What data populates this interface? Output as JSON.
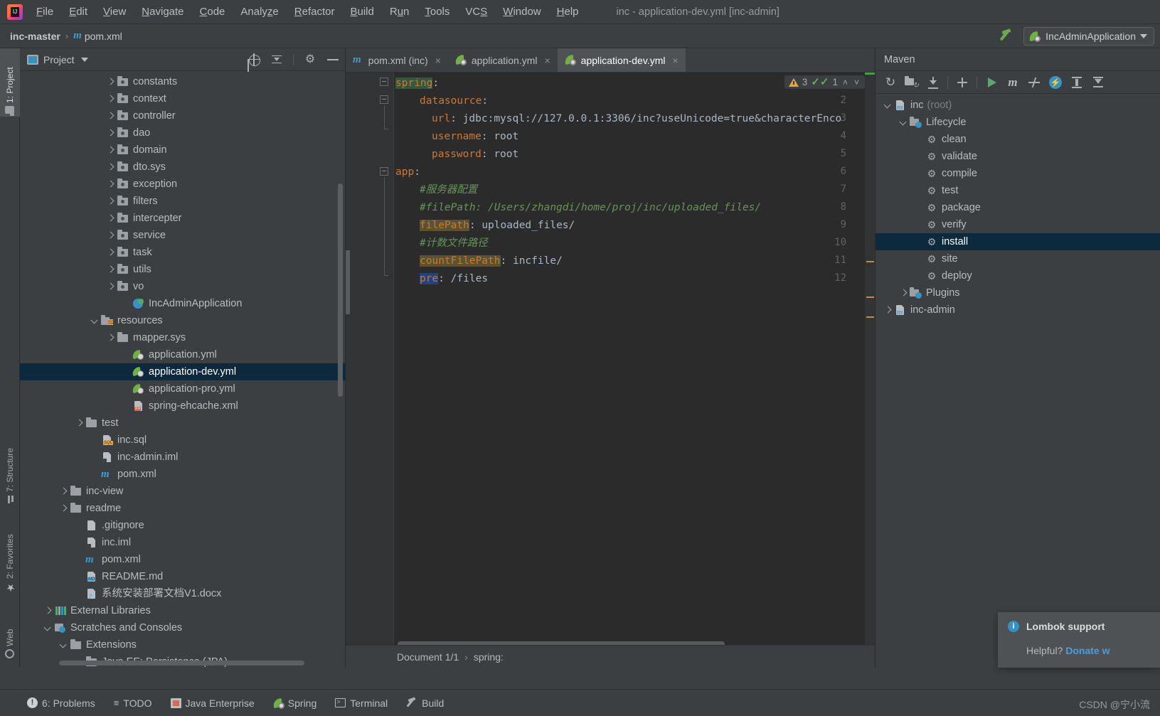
{
  "window": {
    "title": "inc - application-dev.yml [inc-admin]",
    "app_icon": "intellij-idea-logo"
  },
  "menubar": {
    "items": [
      {
        "label": "File",
        "mnemonic": "F"
      },
      {
        "label": "Edit",
        "mnemonic": "E"
      },
      {
        "label": "View",
        "mnemonic": "V"
      },
      {
        "label": "Navigate",
        "mnemonic": "N"
      },
      {
        "label": "Code",
        "mnemonic": "C"
      },
      {
        "label": "Analyze",
        "mnemonic": "z"
      },
      {
        "label": "Refactor",
        "mnemonic": "R"
      },
      {
        "label": "Build",
        "mnemonic": "B"
      },
      {
        "label": "Run",
        "mnemonic": "u"
      },
      {
        "label": "Tools",
        "mnemonic": "T"
      },
      {
        "label": "VCS",
        "mnemonic": "S"
      },
      {
        "label": "Window",
        "mnemonic": "W"
      },
      {
        "label": "Help",
        "mnemonic": "H"
      }
    ]
  },
  "navbar": {
    "crumbs": [
      "inc-master",
      "pom.xml"
    ],
    "separator": "›",
    "build_icon": "hammer-icon",
    "run_config": {
      "label": "IncAdminApplication",
      "icon": "spring-boot-icon",
      "caret": "▼"
    }
  },
  "left_strip": {
    "tabs": [
      {
        "label": "1: Project",
        "icon": "folder-icon",
        "active": true
      },
      {
        "label": "7: Structure",
        "icon": "structure-icon",
        "active": false
      },
      {
        "label": "2: Favorites",
        "icon": "star-icon",
        "active": false
      },
      {
        "label": "Web",
        "icon": "web-icon",
        "active": false
      }
    ]
  },
  "project_panel": {
    "title": "Project",
    "title_icon": "project-view-icon",
    "caret": "▼",
    "toolbar": [
      {
        "name": "locate-icon",
        "title": "Select Opened File"
      },
      {
        "name": "collapse-all-icon",
        "title": "Collapse All"
      },
      {
        "name": "gear-icon",
        "title": "Settings"
      },
      {
        "name": "minimize-icon",
        "title": "Hide"
      }
    ],
    "tree": [
      {
        "label": "constants",
        "indent": 5,
        "arrow": "right",
        "icon": "pkg",
        "selected": false
      },
      {
        "label": "context",
        "indent": 5,
        "arrow": "right",
        "icon": "pkg",
        "selected": false
      },
      {
        "label": "controller",
        "indent": 5,
        "arrow": "right",
        "icon": "pkg",
        "selected": false
      },
      {
        "label": "dao",
        "indent": 5,
        "arrow": "right",
        "icon": "pkg",
        "selected": false
      },
      {
        "label": "domain",
        "indent": 5,
        "arrow": "right",
        "icon": "pkg",
        "selected": false
      },
      {
        "label": "dto.sys",
        "indent": 5,
        "arrow": "right",
        "icon": "pkg",
        "selected": false
      },
      {
        "label": "exception",
        "indent": 5,
        "arrow": "right",
        "icon": "pkg",
        "selected": false
      },
      {
        "label": "filters",
        "indent": 5,
        "arrow": "right",
        "icon": "pkg",
        "selected": false
      },
      {
        "label": "intercepter",
        "indent": 5,
        "arrow": "right",
        "icon": "pkg",
        "selected": false
      },
      {
        "label": "service",
        "indent": 5,
        "arrow": "right",
        "icon": "pkg",
        "selected": false
      },
      {
        "label": "task",
        "indent": 5,
        "arrow": "right",
        "icon": "pkg",
        "selected": false
      },
      {
        "label": "utils",
        "indent": 5,
        "arrow": "right",
        "icon": "pkg",
        "selected": false
      },
      {
        "label": "vo",
        "indent": 5,
        "arrow": "right",
        "icon": "pkg",
        "selected": false
      },
      {
        "label": "IncAdminApplication",
        "indent": 6,
        "arrow": "none",
        "icon": "springapp",
        "selected": false
      },
      {
        "label": "resources",
        "indent": 4,
        "arrow": "down",
        "icon": "resfolder",
        "selected": false
      },
      {
        "label": "mapper.sys",
        "indent": 5,
        "arrow": "right",
        "icon": "folder",
        "selected": false
      },
      {
        "label": "application.yml",
        "indent": 6,
        "arrow": "none",
        "icon": "yml",
        "selected": false
      },
      {
        "label": "application-dev.yml",
        "indent": 6,
        "arrow": "none",
        "icon": "yml",
        "selected": true
      },
      {
        "label": "application-pro.yml",
        "indent": 6,
        "arrow": "none",
        "icon": "yml",
        "selected": false
      },
      {
        "label": "spring-ehcache.xml",
        "indent": 6,
        "arrow": "none",
        "icon": "file-xml",
        "selected": false
      },
      {
        "label": "test",
        "indent": 3,
        "arrow": "right",
        "icon": "folder",
        "selected": false
      },
      {
        "label": "inc.sql",
        "indent": 4,
        "arrow": "none",
        "icon": "file-sql",
        "selected": false
      },
      {
        "label": "inc-admin.iml",
        "indent": 4,
        "arrow": "none",
        "icon": "file-iml",
        "selected": false
      },
      {
        "label": "pom.xml",
        "indent": 4,
        "arrow": "none",
        "icon": "mvn",
        "selected": false
      },
      {
        "label": "inc-view",
        "indent": 2,
        "arrow": "right",
        "icon": "folder",
        "selected": false
      },
      {
        "label": "readme",
        "indent": 2,
        "arrow": "right",
        "icon": "folder",
        "selected": false
      },
      {
        "label": ".gitignore",
        "indent": 3,
        "arrow": "none",
        "icon": "file-gi",
        "selected": false
      },
      {
        "label": "inc.iml",
        "indent": 3,
        "arrow": "none",
        "icon": "file-iml",
        "selected": false
      },
      {
        "label": "pom.xml",
        "indent": 3,
        "arrow": "none",
        "icon": "mvn",
        "selected": false
      },
      {
        "label": "README.md",
        "indent": 3,
        "arrow": "none",
        "icon": "file-md",
        "selected": false
      },
      {
        "label": "系统安装部署文档V1.docx",
        "indent": 3,
        "arrow": "none",
        "icon": "file-q",
        "selected": false
      },
      {
        "label": "External Libraries",
        "indent": 1,
        "arrow": "right",
        "icon": "libs",
        "selected": false
      },
      {
        "label": "Scratches and Consoles",
        "indent": 1,
        "arrow": "down",
        "icon": "scratch",
        "selected": false
      },
      {
        "label": "Extensions",
        "indent": 2,
        "arrow": "down",
        "icon": "folder",
        "selected": false
      },
      {
        "label": "Java EE: Persistence (JPA)",
        "indent": 3,
        "arrow": "down",
        "icon": "folder",
        "selected": false
      }
    ]
  },
  "editor": {
    "tabs": [
      {
        "label": "pom.xml (inc)",
        "icon": "maven-icon",
        "active": false,
        "close": "×"
      },
      {
        "label": "application.yml",
        "icon": "spring-icon",
        "active": false,
        "close": "×"
      },
      {
        "label": "application-dev.yml",
        "icon": "spring-icon",
        "active": true,
        "close": "×"
      }
    ],
    "line_numbers": [
      "1",
      "2",
      "3",
      "4",
      "5",
      "6",
      "7",
      "8",
      "9",
      "10",
      "11",
      "12"
    ],
    "lines": [
      {
        "n": 1,
        "indent": 0,
        "tokens": [
          {
            "t": "spring",
            "c": "tk-spring-hl"
          },
          {
            "t": ":",
            "c": "tk-punct"
          }
        ]
      },
      {
        "n": 2,
        "indent": 2,
        "tokens": [
          {
            "t": "datasource",
            "c": "tk-key"
          },
          {
            "t": ":",
            "c": "tk-punct"
          }
        ]
      },
      {
        "n": 3,
        "indent": 3,
        "tokens": [
          {
            "t": "url",
            "c": "tk-key"
          },
          {
            "t": ": ",
            "c": "tk-punct"
          },
          {
            "t": "jdbc:mysql://127.0.0.1:3306/inc?useUnicode=true&characterEnco",
            "c": "tk-val"
          }
        ]
      },
      {
        "n": 4,
        "indent": 3,
        "tokens": [
          {
            "t": "username",
            "c": "tk-key"
          },
          {
            "t": ": ",
            "c": "tk-punct"
          },
          {
            "t": "root",
            "c": "tk-val"
          }
        ]
      },
      {
        "n": 5,
        "indent": 3,
        "tokens": [
          {
            "t": "password",
            "c": "tk-key"
          },
          {
            "t": ": ",
            "c": "tk-punct"
          },
          {
            "t": "root",
            "c": "tk-val"
          }
        ]
      },
      {
        "n": 6,
        "indent": 0,
        "tokens": [
          {
            "t": "app",
            "c": "tk-key"
          },
          {
            "t": ":",
            "c": "tk-punct"
          }
        ]
      },
      {
        "n": 7,
        "indent": 2,
        "tokens": [
          {
            "t": "#服务器配置",
            "c": "tk-comment"
          }
        ]
      },
      {
        "n": 8,
        "indent": 2,
        "tokens": [
          {
            "t": "#filePath: /Users/zhangdi/home/proj/inc/uploaded_files/",
            "c": "tk-comment"
          }
        ]
      },
      {
        "n": 9,
        "indent": 2,
        "tokens": [
          {
            "t": "filePath",
            "c": "tk-key-hl"
          },
          {
            "t": ": ",
            "c": "tk-punct"
          },
          {
            "t": "uploaded_files/",
            "c": "tk-val"
          }
        ]
      },
      {
        "n": 10,
        "indent": 2,
        "tokens": [
          {
            "t": "#计数文件路径",
            "c": "tk-comment"
          }
        ]
      },
      {
        "n": 11,
        "indent": 2,
        "tokens": [
          {
            "t": "countFilePath",
            "c": "tk-key-hl"
          },
          {
            "t": ": ",
            "c": "tk-punct"
          },
          {
            "t": "incfile/",
            "c": "tk-val"
          }
        ]
      },
      {
        "n": 12,
        "indent": 2,
        "tokens": [
          {
            "t": "pre",
            "c": "tk-key-hl2"
          },
          {
            "t": ": ",
            "c": "tk-punct"
          },
          {
            "t": "/files",
            "c": "tk-val"
          }
        ]
      }
    ],
    "inspection_widget": {
      "warning_icon": "warning-triangle-icon",
      "warning_count": "3",
      "check_icon": "inspection-check-icon",
      "check_count": "1",
      "prev_icon": "˄",
      "next_icon": "˅"
    },
    "breadcrumb": {
      "document": "Document 1/1",
      "separator": "›",
      "node": "spring:"
    }
  },
  "maven_panel": {
    "title": "Maven",
    "toolbar": [
      {
        "name": "reload-all-maven-projects-icon"
      },
      {
        "name": "generate-sources-folders-icon"
      },
      {
        "name": "download-sources-icon"
      },
      {
        "name": "add-maven-project-icon"
      },
      {
        "name": "execute-goal-run-icon"
      },
      {
        "name": "run-maven-build-icon"
      },
      {
        "name": "toggle-skip-tests-icon"
      },
      {
        "name": "toggle-offline-mode-icon"
      },
      {
        "name": "expand-all-icon"
      },
      {
        "name": "collapse-all-icon"
      }
    ],
    "tree": [
      {
        "label": "inc",
        "suffix": "(root)",
        "indent": 0,
        "arrow": "down",
        "icon": "mvnproj",
        "selected": false
      },
      {
        "label": "Lifecycle",
        "suffix": "",
        "indent": 1,
        "arrow": "down",
        "icon": "phasefolder",
        "selected": false
      },
      {
        "label": "clean",
        "suffix": "",
        "indent": 2,
        "arrow": "none",
        "icon": "gear",
        "selected": false
      },
      {
        "label": "validate",
        "suffix": "",
        "indent": 2,
        "arrow": "none",
        "icon": "gear",
        "selected": false
      },
      {
        "label": "compile",
        "suffix": "",
        "indent": 2,
        "arrow": "none",
        "icon": "gear",
        "selected": false
      },
      {
        "label": "test",
        "suffix": "",
        "indent": 2,
        "arrow": "none",
        "icon": "gear",
        "selected": false
      },
      {
        "label": "package",
        "suffix": "",
        "indent": 2,
        "arrow": "none",
        "icon": "gear",
        "selected": false
      },
      {
        "label": "verify",
        "suffix": "",
        "indent": 2,
        "arrow": "none",
        "icon": "gear",
        "selected": false
      },
      {
        "label": "install",
        "suffix": "",
        "indent": 2,
        "arrow": "none",
        "icon": "gear",
        "selected": true
      },
      {
        "label": "site",
        "suffix": "",
        "indent": 2,
        "arrow": "none",
        "icon": "gear",
        "selected": false
      },
      {
        "label": "deploy",
        "suffix": "",
        "indent": 2,
        "arrow": "none",
        "icon": "gear",
        "selected": false
      },
      {
        "label": "Plugins",
        "suffix": "",
        "indent": 1,
        "arrow": "right",
        "icon": "phasefolder",
        "selected": false
      },
      {
        "label": "inc-admin",
        "suffix": "",
        "indent": 0,
        "arrow": "right",
        "icon": "mvnproj",
        "selected": false
      }
    ]
  },
  "notification": {
    "icon": "info-icon",
    "title": "Lombok support",
    "helpful_text": "Helpful?",
    "link_text": "Donate w"
  },
  "statusbar": {
    "items": [
      {
        "label": "6: Problems",
        "mnemonic": "6",
        "icon": "problems-icon"
      },
      {
        "label": "TODO",
        "mnemonic": "",
        "icon": "todo-icon"
      },
      {
        "label": "Java Enterprise",
        "mnemonic": "",
        "icon": "java-enterprise-icon"
      },
      {
        "label": "Spring",
        "mnemonic": "",
        "icon": "spring-icon"
      },
      {
        "label": "Terminal",
        "mnemonic": "",
        "icon": "terminal-icon"
      },
      {
        "label": "Build",
        "mnemonic": "",
        "icon": "build-icon"
      }
    ],
    "watermark": "CSDN @宁小流"
  },
  "colors": {
    "bg": "#3c3f41",
    "editor_bg": "#2b2b2b",
    "selection": "#0d293e",
    "accent_blue": "#3592c4",
    "spring_green": "#6db33f",
    "warning": "#e8a33d",
    "keyword": "#cc7832",
    "comment": "#629755"
  }
}
